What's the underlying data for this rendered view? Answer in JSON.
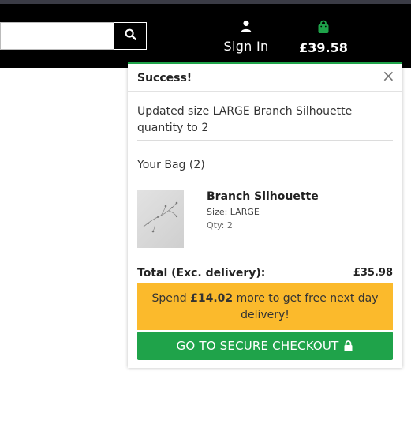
{
  "header": {
    "search": {
      "placeholder": "",
      "button_icon": "search-icon"
    },
    "sign_in_label": "Sign In",
    "bag_total": "£39.58"
  },
  "popup": {
    "title": "Success!",
    "close_label": "×",
    "message": "Updated size LARGE Branch Silhouette quantity to 2",
    "bag_count_label": "Your Bag (2)",
    "item": {
      "name": "Branch Silhouette",
      "size": "Size: LARGE",
      "qty": "Qty: 2"
    },
    "total_label": "Total (Exc. delivery):",
    "total_value": "£35.98",
    "free_delivery": {
      "prefix": "Spend",
      "amount": "£14.02",
      "suffix": "more to get free next day delivery!"
    },
    "checkout_label": "GO TO SECURE CHECKOUT"
  },
  "colors": {
    "header_bg": "#000000",
    "success_green": "#1fa34a",
    "banner_yellow": "#fbba2c"
  }
}
